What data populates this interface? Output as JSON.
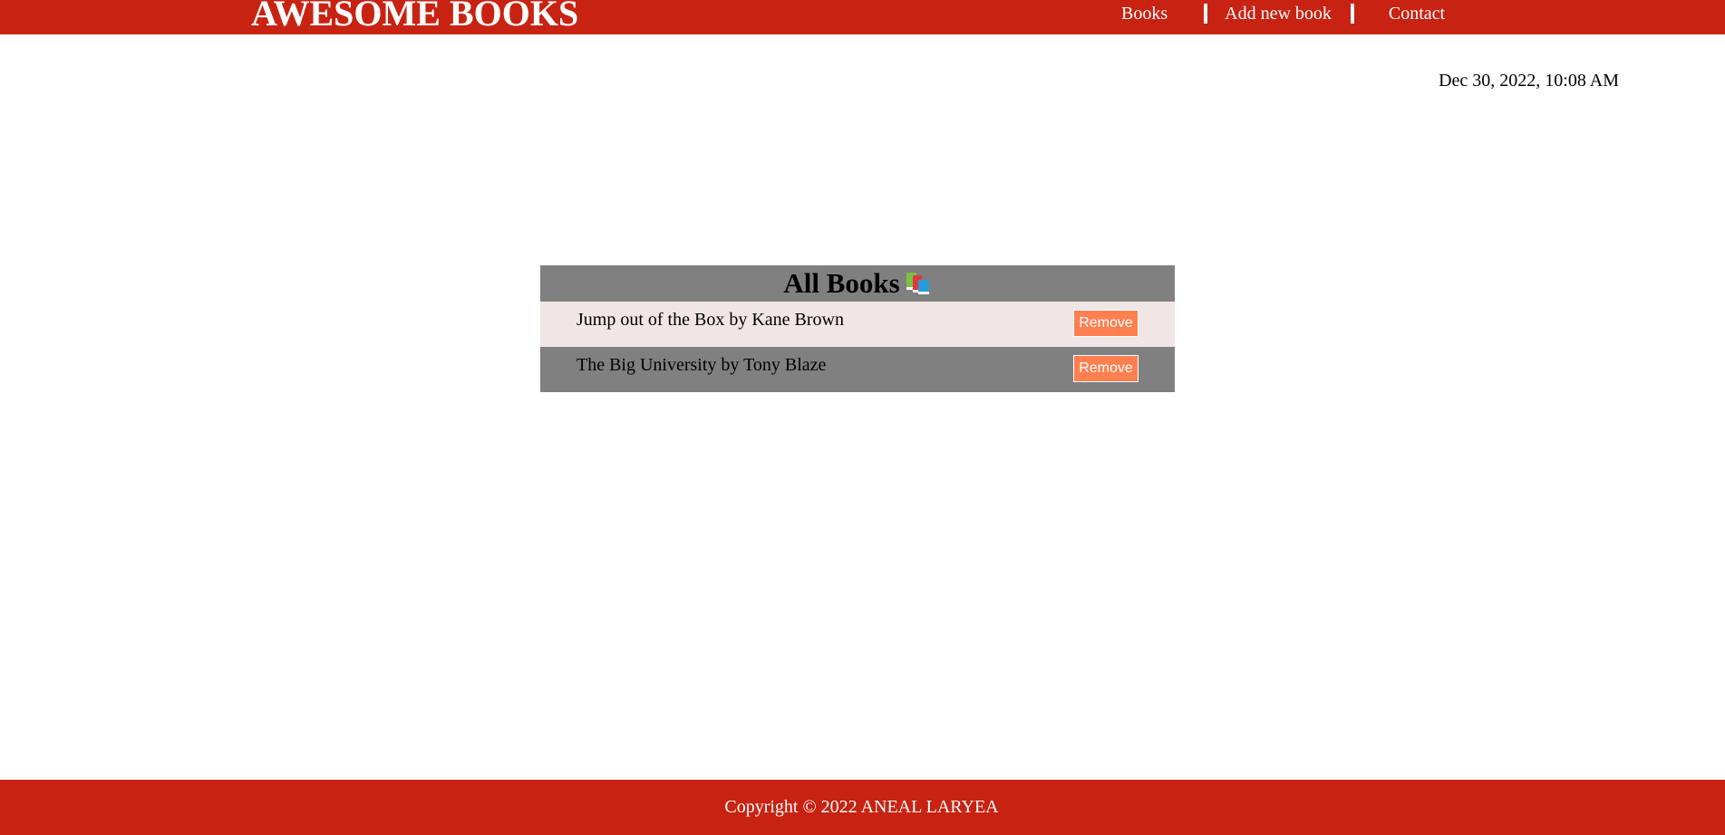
{
  "header": {
    "logo": "AWESOME BOOKS",
    "nav": {
      "books": "Books",
      "add_new_book": "Add new book",
      "contact": "Contact"
    }
  },
  "datetime": "Dec 30, 2022, 10:08 AM",
  "books_section": {
    "title": "All Books",
    "icon": "books-emoji-icon",
    "items": [
      {
        "text": "Jump out of the Box by Kane Brown",
        "remove_label": "Remove"
      },
      {
        "text": "The Big University by Tony Blaze",
        "remove_label": "Remove"
      }
    ]
  },
  "footer": {
    "copyright": "Copyright © 2022 ANEAL LARYEA"
  },
  "colors": {
    "brand_red": "#c82312",
    "row_light": "#f0e6e6",
    "row_dark": "#808080",
    "button": "#ff7f50"
  }
}
